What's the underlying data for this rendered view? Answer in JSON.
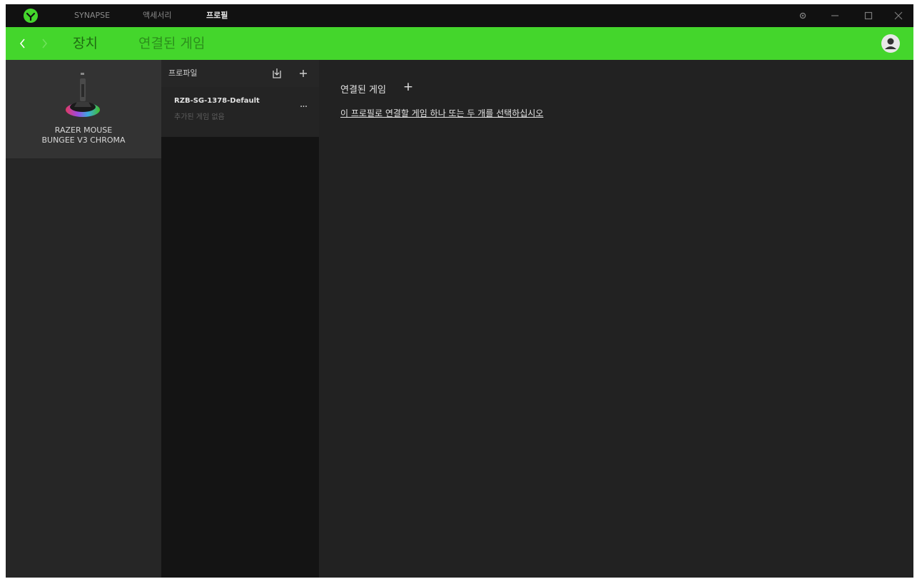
{
  "titlebar": {
    "nav": [
      {
        "label": "SYNAPSE",
        "active": false
      },
      {
        "label": "액세서리",
        "active": false
      },
      {
        "label": "프로필",
        "active": true
      }
    ]
  },
  "header": {
    "tabs": [
      {
        "label": "장치",
        "active": true
      },
      {
        "label": "연결된 게임",
        "active": false
      }
    ]
  },
  "device": {
    "name_line1": "RAZER MOUSE",
    "name_line2": "BUNGEE V3 CHROMA"
  },
  "profiles": {
    "title": "프로파일",
    "items": [
      {
        "name": "RZB-SG-1378-Default",
        "subtitle": "추가된 게임 없음",
        "more": "···"
      }
    ]
  },
  "main": {
    "section_title": "연결된 게임",
    "add_symbol": "+",
    "link_text": "이 프로필로 연결할 게임 하나 또는 두 개를 선택하십시오"
  },
  "colors": {
    "accent": "#44d62c",
    "titlebar": "#111111",
    "background": "#222222"
  }
}
